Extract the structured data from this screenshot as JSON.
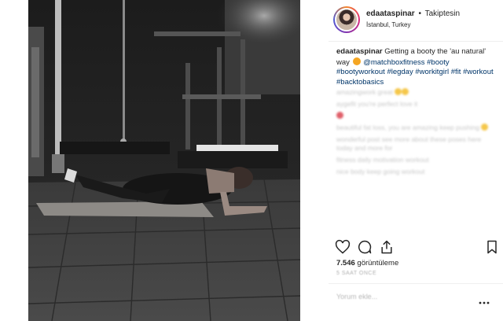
{
  "post": {
    "username": "edaataspinar",
    "separator": "•",
    "follow_status": "Takiptesin",
    "location": "İstanbul, Turkey",
    "caption_user": "edaataspinar",
    "caption_text_1": "Getting a ",
    "caption_text_2": " booty the 'au natural' way",
    "caption_mention": "@matchboxfitness",
    "hashtags": [
      "#booty",
      "#bootyworkout",
      "#legday",
      "#workitgirl",
      "#fit",
      "#workout",
      "#backtobasics"
    ],
    "views_count": "7.546",
    "views_label": "görüntüleme",
    "timestamp": "5 SAAT ÖNCE",
    "add_comment_placeholder": "Yorum ekle..."
  },
  "comments": [
    {
      "text": "amazingwork great"
    },
    {
      "text": "aygefit you're perfect love it"
    },
    {
      "text": "beautiful fat loss, you are amazing keep pushing"
    },
    {
      "text": "wonderful post see more about these poses here today and more for"
    },
    {
      "text": "fitness daily motivation workout"
    },
    {
      "text": "nice body keep going workout"
    }
  ],
  "icons": {
    "heart": "heart-icon",
    "comment": "comment-icon",
    "share": "share-icon",
    "save": "bookmark-icon",
    "more": "more-horizontal-icon"
  },
  "colors": {
    "link": "#003569",
    "text": "#262626",
    "muted": "#b8b8b8"
  }
}
